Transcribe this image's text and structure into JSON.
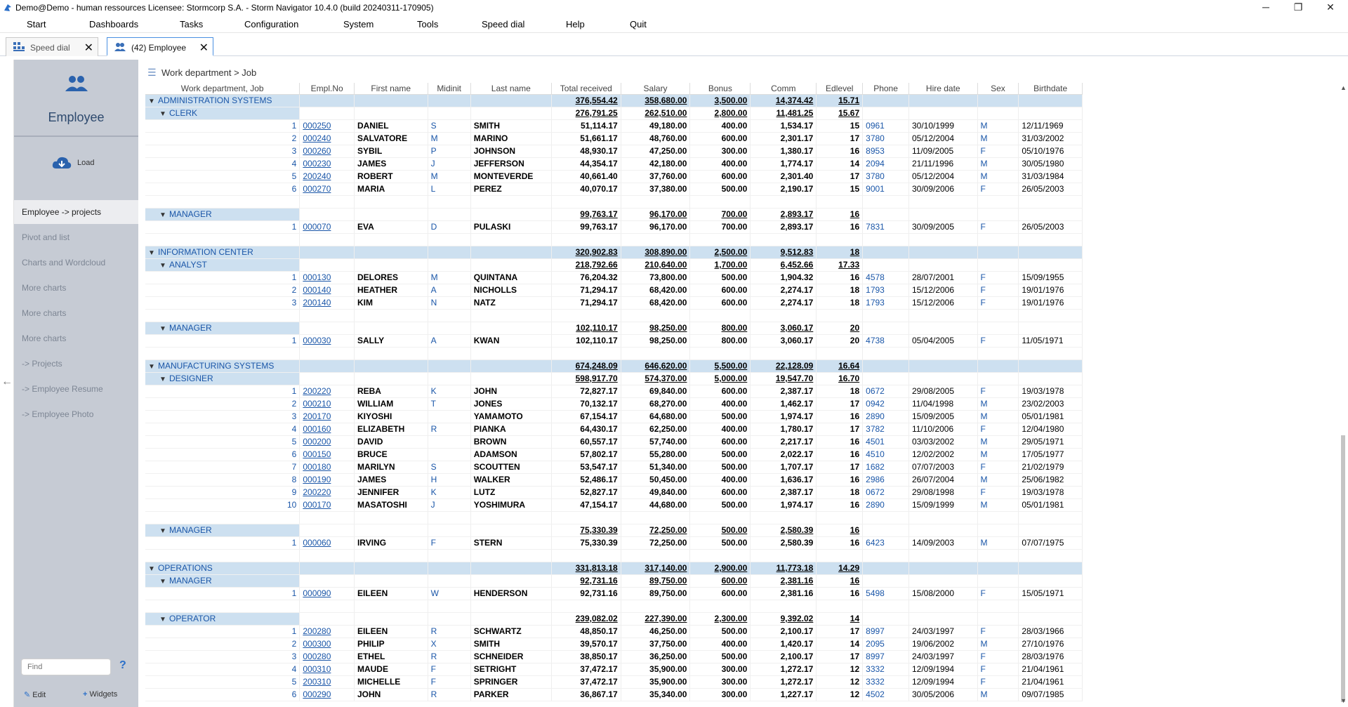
{
  "window": {
    "title": "Demo@Demo - human ressources    Licensee: Stormcorp S.A. -  Storm Navigator 10.4.0 (build 20240311-170905)",
    "minimize": "─",
    "maximize": "❐",
    "close": "✕"
  },
  "menu": [
    "Start",
    "Dashboards",
    "Tasks",
    "Configuration",
    "System",
    "Tools",
    "Speed dial",
    "Help",
    "Quit"
  ],
  "tabs": [
    {
      "label": "Speed dial",
      "close": "✕"
    },
    {
      "label": "(42) Employee",
      "close": "✕"
    }
  ],
  "sidebar": {
    "title": "Employee",
    "load_label": "Load",
    "items": [
      "Employee -> projects",
      "Pivot and list",
      "Charts and Wordcloud",
      "More charts",
      "More charts",
      "More charts",
      "-> Projects",
      "-> Employee Resume",
      "-> Employee Photo"
    ],
    "find_placeholder": "Find",
    "help": "?",
    "edit_label": "Edit",
    "widgets_label": "Widgets"
  },
  "breadcrumb": "Work department > Job",
  "columns": [
    "Work department, Job",
    "Empl.No",
    "First name",
    "Midinit",
    "Last name",
    "Total received",
    "Salary",
    "Bonus",
    "Comm",
    "Edlevel",
    "Phone",
    "Hire date",
    "Sex",
    "Birthdate"
  ],
  "rows": [
    {
      "t": "dept",
      "label": "ADMINISTRATION SYSTEMS",
      "total": "376,554.42",
      "salary": "358,680.00",
      "bonus": "3,500.00",
      "comm": "14,374.42",
      "edlevel": "15.71"
    },
    {
      "t": "job",
      "label": "CLERK",
      "total": "276,791.25",
      "salary": "262,510.00",
      "bonus": "2,800.00",
      "comm": "11,481.25",
      "edlevel": "15.67"
    },
    {
      "t": "emp",
      "idx": "1",
      "empno": "000250",
      "first": "DANIEL",
      "mid": "S",
      "last": "SMITH",
      "total": "51,114.17",
      "salary": "49,180.00",
      "bonus": "400.00",
      "comm": "1,534.17",
      "edlevel": "15",
      "phone": "0961",
      "hire": "30/10/1999",
      "sex": "M",
      "birth": "12/11/1969"
    },
    {
      "t": "emp",
      "idx": "2",
      "empno": "000240",
      "first": "SALVATORE",
      "mid": "M",
      "last": "MARINO",
      "total": "51,661.17",
      "salary": "48,760.00",
      "bonus": "600.00",
      "comm": "2,301.17",
      "edlevel": "17",
      "phone": "3780",
      "hire": "05/12/2004",
      "sex": "M",
      "birth": "31/03/2002"
    },
    {
      "t": "emp",
      "idx": "3",
      "empno": "000260",
      "first": "SYBIL",
      "mid": "P",
      "last": "JOHNSON",
      "total": "48,930.17",
      "salary": "47,250.00",
      "bonus": "300.00",
      "comm": "1,380.17",
      "edlevel": "16",
      "phone": "8953",
      "hire": "11/09/2005",
      "sex": "F",
      "birth": "05/10/1976"
    },
    {
      "t": "emp",
      "idx": "4",
      "empno": "000230",
      "first": "JAMES",
      "mid": "J",
      "last": "JEFFERSON",
      "total": "44,354.17",
      "salary": "42,180.00",
      "bonus": "400.00",
      "comm": "1,774.17",
      "edlevel": "14",
      "phone": "2094",
      "hire": "21/11/1996",
      "sex": "M",
      "birth": "30/05/1980"
    },
    {
      "t": "emp",
      "idx": "5",
      "empno": "200240",
      "first": "ROBERT",
      "mid": "M",
      "last": "MONTEVERDE",
      "total": "40,661.40",
      "salary": "37,760.00",
      "bonus": "600.00",
      "comm": "2,301.40",
      "edlevel": "17",
      "phone": "3780",
      "hire": "05/12/2004",
      "sex": "M",
      "birth": "31/03/1984"
    },
    {
      "t": "emp",
      "idx": "6",
      "empno": "000270",
      "first": "MARIA",
      "mid": "L",
      "last": "PEREZ",
      "total": "40,070.17",
      "salary": "37,380.00",
      "bonus": "500.00",
      "comm": "2,190.17",
      "edlevel": "15",
      "phone": "9001",
      "hire": "30/09/2006",
      "sex": "F",
      "birth": "26/05/2003"
    },
    {
      "t": "blank"
    },
    {
      "t": "job",
      "label": "MANAGER",
      "total": "99,763.17",
      "salary": "96,170.00",
      "bonus": "700.00",
      "comm": "2,893.17",
      "edlevel": "16"
    },
    {
      "t": "emp",
      "idx": "1",
      "empno": "000070",
      "first": "EVA",
      "mid": "D",
      "last": "PULASKI",
      "total": "99,763.17",
      "salary": "96,170.00",
      "bonus": "700.00",
      "comm": "2,893.17",
      "edlevel": "16",
      "phone": "7831",
      "hire": "30/09/2005",
      "sex": "F",
      "birth": "26/05/2003"
    },
    {
      "t": "blank"
    },
    {
      "t": "dept",
      "label": "INFORMATION CENTER",
      "total": "320,902.83",
      "salary": "308,890.00",
      "bonus": "2,500.00",
      "comm": "9,512.83",
      "edlevel": "18"
    },
    {
      "t": "job",
      "label": "ANALYST",
      "total": "218,792.66",
      "salary": "210,640.00",
      "bonus": "1,700.00",
      "comm": "6,452.66",
      "edlevel": "17.33"
    },
    {
      "t": "emp",
      "idx": "1",
      "empno": "000130",
      "first": "DELORES",
      "mid": "M",
      "last": "QUINTANA",
      "total": "76,204.32",
      "salary": "73,800.00",
      "bonus": "500.00",
      "comm": "1,904.32",
      "edlevel": "16",
      "phone": "4578",
      "hire": "28/07/2001",
      "sex": "F",
      "birth": "15/09/1955"
    },
    {
      "t": "emp",
      "idx": "2",
      "empno": "000140",
      "first": "HEATHER",
      "mid": "A",
      "last": "NICHOLLS",
      "total": "71,294.17",
      "salary": "68,420.00",
      "bonus": "600.00",
      "comm": "2,274.17",
      "edlevel": "18",
      "phone": "1793",
      "hire": "15/12/2006",
      "sex": "F",
      "birth": "19/01/1976"
    },
    {
      "t": "emp",
      "idx": "3",
      "empno": "200140",
      "first": "KIM",
      "mid": "N",
      "last": "NATZ",
      "total": "71,294.17",
      "salary": "68,420.00",
      "bonus": "600.00",
      "comm": "2,274.17",
      "edlevel": "18",
      "phone": "1793",
      "hire": "15/12/2006",
      "sex": "F",
      "birth": "19/01/1976"
    },
    {
      "t": "blank"
    },
    {
      "t": "job",
      "label": "MANAGER",
      "total": "102,110.17",
      "salary": "98,250.00",
      "bonus": "800.00",
      "comm": "3,060.17",
      "edlevel": "20"
    },
    {
      "t": "emp",
      "idx": "1",
      "empno": "000030",
      "first": "SALLY",
      "mid": "A",
      "last": "KWAN",
      "total": "102,110.17",
      "salary": "98,250.00",
      "bonus": "800.00",
      "comm": "3,060.17",
      "edlevel": "20",
      "phone": "4738",
      "hire": "05/04/2005",
      "sex": "F",
      "birth": "11/05/1971"
    },
    {
      "t": "blank"
    },
    {
      "t": "dept",
      "label": "MANUFACTURING SYSTEMS",
      "total": "674,248.09",
      "salary": "646,620.00",
      "bonus": "5,500.00",
      "comm": "22,128.09",
      "edlevel": "16.64"
    },
    {
      "t": "job",
      "label": "DESIGNER",
      "total": "598,917.70",
      "salary": "574,370.00",
      "bonus": "5,000.00",
      "comm": "19,547.70",
      "edlevel": "16.70"
    },
    {
      "t": "emp",
      "idx": "1",
      "empno": "200220",
      "first": "REBA",
      "mid": "K",
      "last": "JOHN",
      "total": "72,827.17",
      "salary": "69,840.00",
      "bonus": "600.00",
      "comm": "2,387.17",
      "edlevel": "18",
      "phone": "0672",
      "hire": "29/08/2005",
      "sex": "F",
      "birth": "19/03/1978"
    },
    {
      "t": "emp",
      "idx": "2",
      "empno": "000210",
      "first": "WILLIAM",
      "mid": "T",
      "last": "JONES",
      "total": "70,132.17",
      "salary": "68,270.00",
      "bonus": "400.00",
      "comm": "1,462.17",
      "edlevel": "17",
      "phone": "0942",
      "hire": "11/04/1998",
      "sex": "M",
      "birth": "23/02/2003"
    },
    {
      "t": "emp",
      "idx": "3",
      "empno": "200170",
      "first": "KIYOSHI",
      "mid": "",
      "last": "YAMAMOTO",
      "total": "67,154.17",
      "salary": "64,680.00",
      "bonus": "500.00",
      "comm": "1,974.17",
      "edlevel": "16",
      "phone": "2890",
      "hire": "15/09/2005",
      "sex": "M",
      "birth": "05/01/1981"
    },
    {
      "t": "emp",
      "idx": "4",
      "empno": "000160",
      "first": "ELIZABETH",
      "mid": "R",
      "last": "PIANKA",
      "total": "64,430.17",
      "salary": "62,250.00",
      "bonus": "400.00",
      "comm": "1,780.17",
      "edlevel": "17",
      "phone": "3782",
      "hire": "11/10/2006",
      "sex": "F",
      "birth": "12/04/1980"
    },
    {
      "t": "emp",
      "idx": "5",
      "empno": "000200",
      "first": "DAVID",
      "mid": "",
      "last": "BROWN",
      "total": "60,557.17",
      "salary": "57,740.00",
      "bonus": "600.00",
      "comm": "2,217.17",
      "edlevel": "16",
      "phone": "4501",
      "hire": "03/03/2002",
      "sex": "M",
      "birth": "29/05/1971"
    },
    {
      "t": "emp",
      "idx": "6",
      "empno": "000150",
      "first": "BRUCE",
      "mid": "",
      "last": "ADAMSON",
      "total": "57,802.17",
      "salary": "55,280.00",
      "bonus": "500.00",
      "comm": "2,022.17",
      "edlevel": "16",
      "phone": "4510",
      "hire": "12/02/2002",
      "sex": "M",
      "birth": "17/05/1977"
    },
    {
      "t": "emp",
      "idx": "7",
      "empno": "000180",
      "first": "MARILYN",
      "mid": "S",
      "last": "SCOUTTEN",
      "total": "53,547.17",
      "salary": "51,340.00",
      "bonus": "500.00",
      "comm": "1,707.17",
      "edlevel": "17",
      "phone": "1682",
      "hire": "07/07/2003",
      "sex": "F",
      "birth": "21/02/1979"
    },
    {
      "t": "emp",
      "idx": "8",
      "empno": "000190",
      "first": "JAMES",
      "mid": "H",
      "last": "WALKER",
      "total": "52,486.17",
      "salary": "50,450.00",
      "bonus": "400.00",
      "comm": "1,636.17",
      "edlevel": "16",
      "phone": "2986",
      "hire": "26/07/2004",
      "sex": "M",
      "birth": "25/06/1982"
    },
    {
      "t": "emp",
      "idx": "9",
      "empno": "200220",
      "first": "JENNIFER",
      "mid": "K",
      "last": "LUTZ",
      "total": "52,827.17",
      "salary": "49,840.00",
      "bonus": "600.00",
      "comm": "2,387.17",
      "edlevel": "18",
      "phone": "0672",
      "hire": "29/08/1998",
      "sex": "F",
      "birth": "19/03/1978"
    },
    {
      "t": "emp",
      "idx": "10",
      "empno": "000170",
      "first": "MASATOSHI",
      "mid": "J",
      "last": "YOSHIMURA",
      "total": "47,154.17",
      "salary": "44,680.00",
      "bonus": "500.00",
      "comm": "1,974.17",
      "edlevel": "16",
      "phone": "2890",
      "hire": "15/09/1999",
      "sex": "M",
      "birth": "05/01/1981"
    },
    {
      "t": "blank"
    },
    {
      "t": "job",
      "label": "MANAGER",
      "total": "75,330.39",
      "salary": "72,250.00",
      "bonus": "500.00",
      "comm": "2,580.39",
      "edlevel": "16"
    },
    {
      "t": "emp",
      "idx": "1",
      "empno": "000060",
      "first": "IRVING",
      "mid": "F",
      "last": "STERN",
      "total": "75,330.39",
      "salary": "72,250.00",
      "bonus": "500.00",
      "comm": "2,580.39",
      "edlevel": "16",
      "phone": "6423",
      "hire": "14/09/2003",
      "sex": "M",
      "birth": "07/07/1975"
    },
    {
      "t": "blank"
    },
    {
      "t": "dept",
      "label": "OPERATIONS",
      "total": "331,813.18",
      "salary": "317,140.00",
      "bonus": "2,900.00",
      "comm": "11,773.18",
      "edlevel": "14.29"
    },
    {
      "t": "job",
      "label": "MANAGER",
      "total": "92,731.16",
      "salary": "89,750.00",
      "bonus": "600.00",
      "comm": "2,381.16",
      "edlevel": "16"
    },
    {
      "t": "emp",
      "idx": "1",
      "empno": "000090",
      "first": "EILEEN",
      "mid": "W",
      "last": "HENDERSON",
      "total": "92,731.16",
      "salary": "89,750.00",
      "bonus": "600.00",
      "comm": "2,381.16",
      "edlevel": "16",
      "phone": "5498",
      "hire": "15/08/2000",
      "sex": "F",
      "birth": "15/05/1971"
    },
    {
      "t": "blank"
    },
    {
      "t": "job",
      "label": "OPERATOR",
      "total": "239,082.02",
      "salary": "227,390.00",
      "bonus": "2,300.00",
      "comm": "9,392.02",
      "edlevel": "14"
    },
    {
      "t": "emp",
      "idx": "1",
      "empno": "200280",
      "first": "EILEEN",
      "mid": "R",
      "last": "SCHWARTZ",
      "total": "48,850.17",
      "salary": "46,250.00",
      "bonus": "500.00",
      "comm": "2,100.17",
      "edlevel": "17",
      "phone": "8997",
      "hire": "24/03/1997",
      "sex": "F",
      "birth": "28/03/1966"
    },
    {
      "t": "emp",
      "idx": "2",
      "empno": "000300",
      "first": "PHILIP",
      "mid": "X",
      "last": "SMITH",
      "total": "39,570.17",
      "salary": "37,750.00",
      "bonus": "400.00",
      "comm": "1,420.17",
      "edlevel": "14",
      "phone": "2095",
      "hire": "19/06/2002",
      "sex": "M",
      "birth": "27/10/1976"
    },
    {
      "t": "emp",
      "idx": "3",
      "empno": "000280",
      "first": "ETHEL",
      "mid": "R",
      "last": "SCHNEIDER",
      "total": "38,850.17",
      "salary": "36,250.00",
      "bonus": "500.00",
      "comm": "2,100.17",
      "edlevel": "17",
      "phone": "8997",
      "hire": "24/03/1997",
      "sex": "F",
      "birth": "28/03/1976"
    },
    {
      "t": "emp",
      "idx": "4",
      "empno": "000310",
      "first": "MAUDE",
      "mid": "F",
      "last": "SETRIGHT",
      "total": "37,472.17",
      "salary": "35,900.00",
      "bonus": "300.00",
      "comm": "1,272.17",
      "edlevel": "12",
      "phone": "3332",
      "hire": "12/09/1994",
      "sex": "F",
      "birth": "21/04/1961"
    },
    {
      "t": "emp",
      "idx": "5",
      "empno": "200310",
      "first": "MICHELLE",
      "mid": "F",
      "last": "SPRINGER",
      "total": "37,472.17",
      "salary": "35,900.00",
      "bonus": "300.00",
      "comm": "1,272.17",
      "edlevel": "12",
      "phone": "3332",
      "hire": "12/09/1994",
      "sex": "F",
      "birth": "21/04/1961"
    },
    {
      "t": "emp",
      "idx": "6",
      "empno": "000290",
      "first": "JOHN",
      "mid": "R",
      "last": "PARKER",
      "total": "36,867.17",
      "salary": "35,340.00",
      "bonus": "300.00",
      "comm": "1,227.17",
      "edlevel": "12",
      "phone": "4502",
      "hire": "30/05/2006",
      "sex": "M",
      "birth": "09/07/1985"
    }
  ]
}
